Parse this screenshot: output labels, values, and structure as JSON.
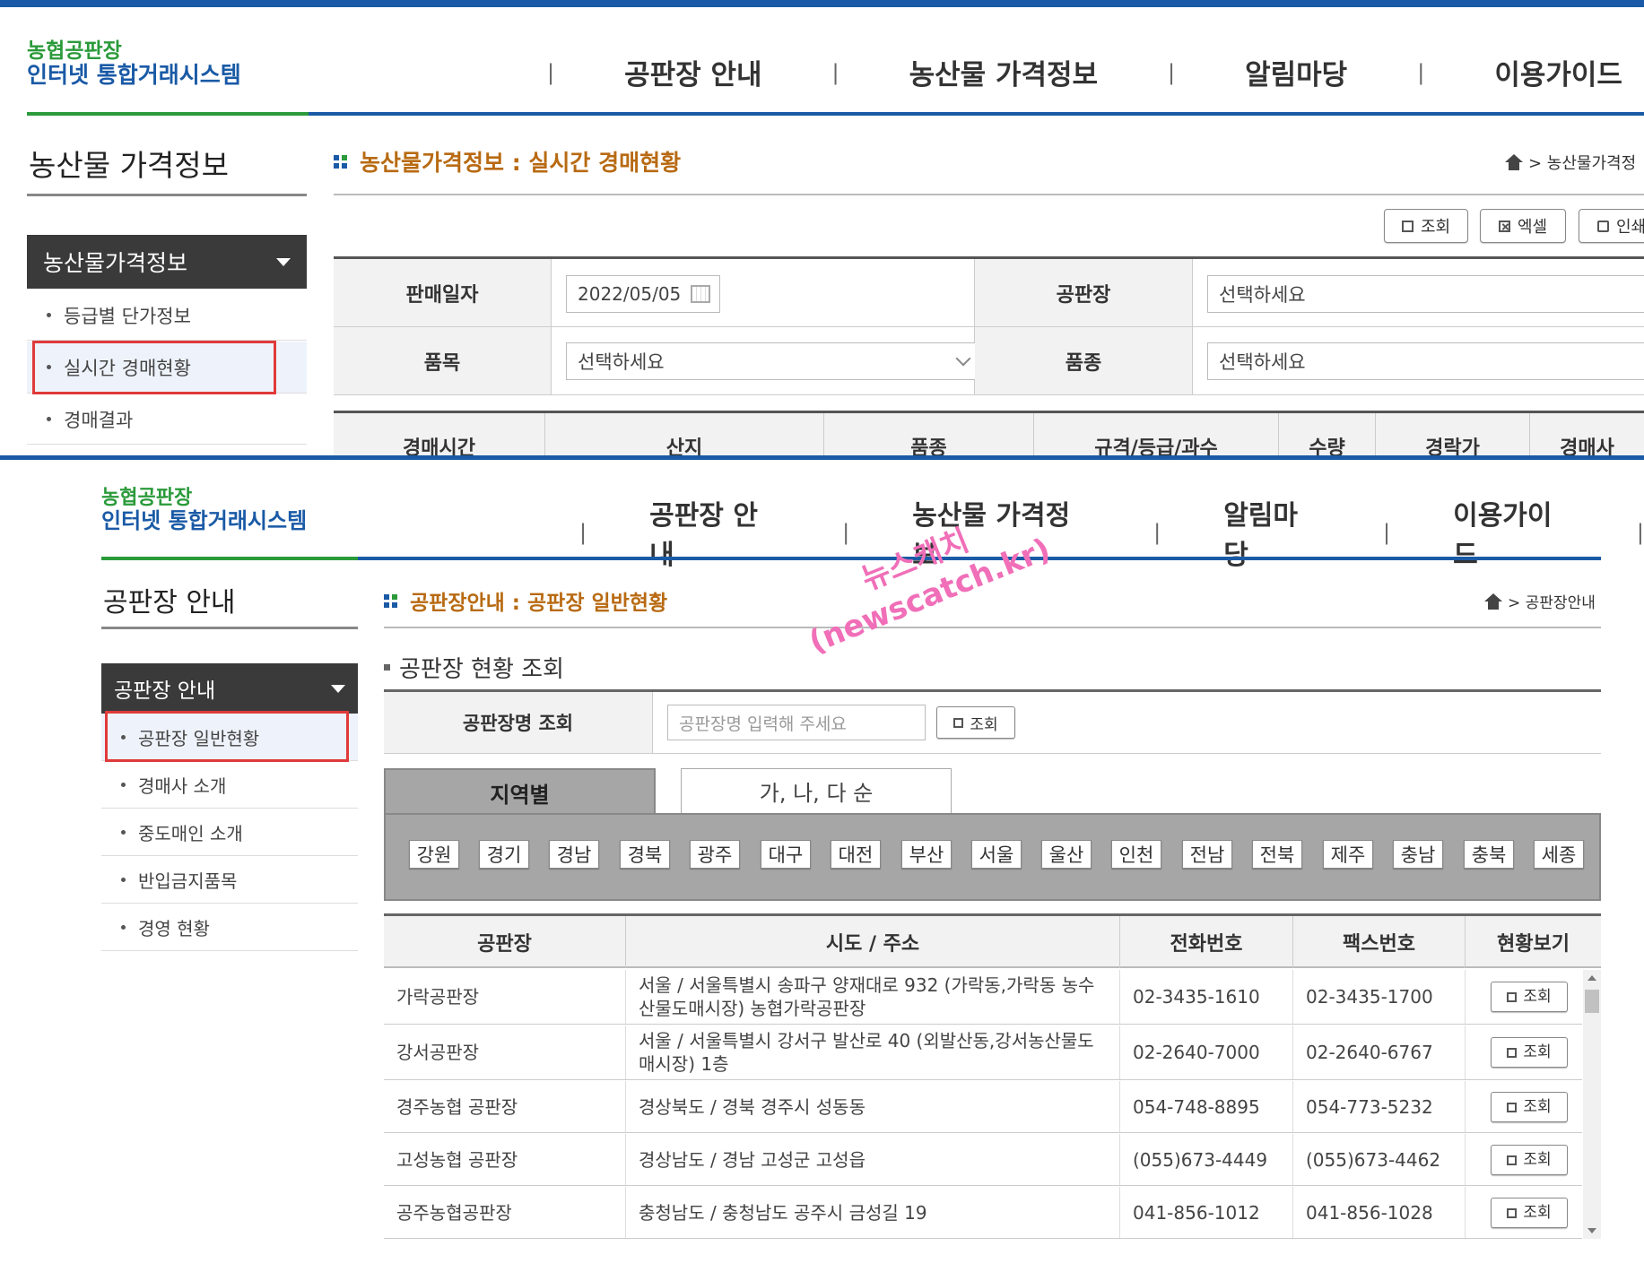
{
  "panel1": {
    "logo": {
      "line1": "농협공판장",
      "line2": "인터넷 통합거래시스템"
    },
    "gnb": [
      "공판장 안내",
      "농산물 가격정보",
      "알림마당",
      "이용가이드"
    ],
    "section_title": "농산물 가격정보",
    "menu_head": "농산물가격정보",
    "submenu": [
      "등급별 단가정보",
      "실시간 경매현황",
      "경매결과"
    ],
    "page_title": "농산물가격정보 : 실시간 경매현황",
    "breadcrumb": "> 농산물가격정",
    "buttons": {
      "search": "조회",
      "excel": "엑셀",
      "print": "인쇄"
    },
    "form": {
      "sale_date_label": "판매일자",
      "sale_date_value": "2022/05/05",
      "market_label": "공판장",
      "market_value": "선택하세요",
      "item_label": "품목",
      "item_value": "선택하세요",
      "variety_label": "품종",
      "variety_value": "선택하세요"
    },
    "result_headers": [
      "경매시간",
      "산지",
      "품종",
      "규격/등급/과수",
      "수량",
      "경락가",
      "경매사"
    ]
  },
  "panel2": {
    "logo": {
      "line1": "농협공판장",
      "line2": "인터넷 통합거래시스템"
    },
    "gnb": [
      "공판장 안내",
      "농산물 가격정보",
      "알림마당",
      "이용가이드"
    ],
    "section_title": "공판장 안내",
    "menu_head": "공판장 안내",
    "submenu": [
      "공판장 일반현황",
      "경매사 소개",
      "중도매인 소개",
      "반입금지품목",
      "경영 현황"
    ],
    "page_title": "공판장안내 : 공판장 일반현황",
    "breadcrumb": "> 공판장안내",
    "sub_title": "공판장 현황 조회",
    "search": {
      "label": "공판장명 조회",
      "placeholder": "공판장명 입력해 주세요",
      "button": "조회"
    },
    "tabs": [
      "지역별",
      "가, 나, 다 순"
    ],
    "regions": [
      "강원",
      "경기",
      "경남",
      "경북",
      "광주",
      "대구",
      "대전",
      "부산",
      "서울",
      "울산",
      "인천",
      "전남",
      "전북",
      "제주",
      "충남",
      "충북",
      "세종"
    ],
    "table": {
      "headers": [
        "공판장",
        "시도 / 주소",
        "전화번호",
        "팩스번호",
        "현황보기"
      ],
      "rows": [
        {
          "name": "가락공판장",
          "addr1": "서울 / 서울특별시 송파구 양재대로 932 (가락동,가락동 농수",
          "addr2": "산물도매시장) 농협가락공판장",
          "tel": "02-3435-1610",
          "fax": "02-3435-1700",
          "btn": "조회"
        },
        {
          "name": "강서공판장",
          "addr1": "서울 / 서울특별시 강서구 발산로 40 (외발산동,강서농산물도",
          "addr2": "매시장) 1층",
          "tel": "02-2640-7000",
          "fax": "02-2640-6767",
          "btn": "조회"
        },
        {
          "name": "경주농협 공판장",
          "addr1": "경상북도 / 경북 경주시 성동동",
          "addr2": "",
          "tel": "054-748-8895",
          "fax": "054-773-5232",
          "btn": "조회"
        },
        {
          "name": "고성농협 공판장",
          "addr1": "경상남도 / 경남 고성군 고성읍",
          "addr2": "",
          "tel": "(055)673-4449",
          "fax": "(055)673-4462",
          "btn": "조회"
        },
        {
          "name": "공주농협공판장",
          "addr1": "충청남도 / 충청남도 공주시 금성길 19",
          "addr2": "",
          "tel": "041-856-1012",
          "fax": "041-856-1028",
          "btn": "조회"
        }
      ]
    }
  },
  "watermark": {
    "line1": "뉴스캐치",
    "line2": "(newscatch.kr)"
  },
  "colors": {
    "brand_blue": "#1a5aa6",
    "brand_green": "#2a9a3a",
    "title_orange": "#b86a12",
    "highlight_red": "#e03a3a",
    "watermark_pink": "#f06fb8"
  }
}
